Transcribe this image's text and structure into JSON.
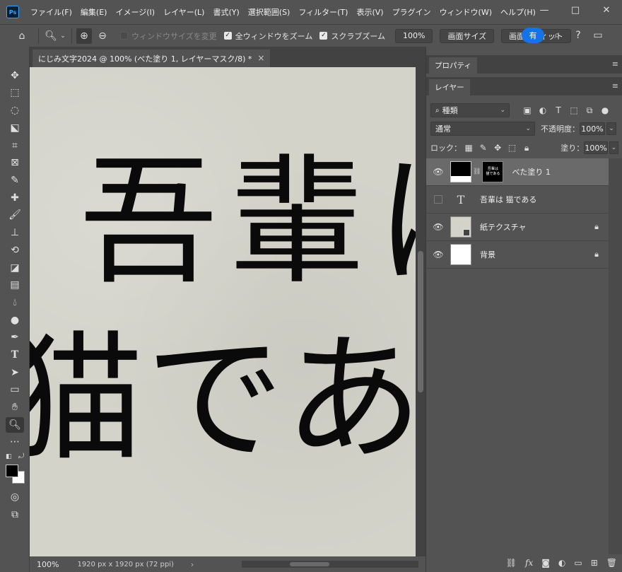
{
  "app": {
    "logo": "Ps",
    "menu": [
      "ファイル(F)",
      "編集(E)",
      "イメージ(I)",
      "レイヤー(L)",
      "書式(Y)",
      "選択範囲(S)",
      "フィルター(T)",
      "表示(V)",
      "プラグイン",
      "ウィンドウ(W)",
      "ヘルプ(H)"
    ],
    "window_controls": {
      "minimize": "—",
      "maximize": "□",
      "close": "✕"
    }
  },
  "options": {
    "resize_windows_label": "ウィンドウサイズを変更",
    "zoom_all_label": "全ウィンドウをズーム",
    "scrubby_label": "スクラブズーム",
    "zoom_value": "100%",
    "fit_screen_label": "画面サイズ",
    "fill_screen_label": "画面にフィット",
    "share_label": "有"
  },
  "document": {
    "tab_title": "にじみ文字2024 @ 100% (べた塗り 1, レイヤーマスク/8) *",
    "close": "×",
    "canvas_line1": "吾輩は",
    "canvas_line2": "猫であ",
    "status_zoom": "100%",
    "status_info": "1920 px x 1920 px (72 ppi)",
    "status_arrow": "›"
  },
  "panels": {
    "properties_tab": "プロパティ",
    "layers_tab": "レイヤー",
    "filter_kind": "種類",
    "blend_mode": "通常",
    "opacity_label": "不透明度：",
    "opacity_value": "100%",
    "lock_label": "ロック：",
    "fill_label": "塗り：",
    "fill_value": "100%",
    "layers": [
      {
        "name": "べた塗り 1",
        "mask_text": "吾輩は\n猫である"
      },
      {
        "name": "吾輩は 猫である",
        "type_icon": "T"
      },
      {
        "name": "紙テクスチャ"
      },
      {
        "name": "背景"
      }
    ]
  },
  "colors": {
    "accent": "#1473e6",
    "canvas_paper": "#d3d3ca",
    "ui_bg": "#535353"
  }
}
